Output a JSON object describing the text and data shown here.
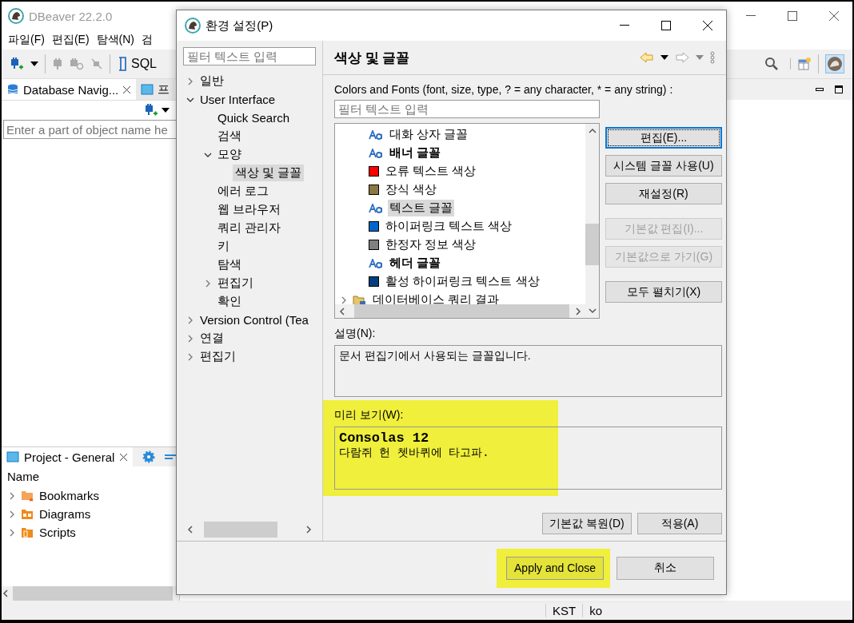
{
  "app_window": {
    "title": "DBeaver 22.2.0",
    "menu": [
      "파일(F)",
      "편집(E)",
      "탐색(N)",
      "검"
    ],
    "toolbar": {
      "sql_label": "SQL"
    },
    "navigator": {
      "tabs": [
        {
          "label": "Database Navig...",
          "selected": true,
          "closable": true
        },
        {
          "label": "프",
          "selected": false,
          "closable": false
        }
      ],
      "search": {
        "placeholder": "Enter a part of object name he"
      }
    },
    "project": {
      "tab": "Project - General",
      "column": "Name",
      "items": [
        {
          "kind": "bookmarks",
          "label": "Bookmarks",
          "expanded": false
        },
        {
          "kind": "diagrams",
          "label": "Diagrams",
          "expanded": false
        },
        {
          "kind": "scripts",
          "label": "Scripts",
          "expanded": false
        }
      ]
    },
    "status_bar": [
      "KST",
      "ko"
    ]
  },
  "dialog": {
    "title": "환경 설정(P)",
    "filter": {
      "placeholder": "필터 텍스트 입력"
    },
    "tree": [
      {
        "label": "일반",
        "expanded": false,
        "selected": false
      },
      {
        "label": "User Interface",
        "expanded": true,
        "selected": false,
        "children": [
          {
            "label": "Quick Search",
            "selected": false
          },
          {
            "label": "검색",
            "selected": false
          },
          {
            "label": "모양",
            "expanded": true,
            "selected": false,
            "children": [
              {
                "label": "색상 및 글꼴",
                "selected": true
              }
            ]
          },
          {
            "label": "에러 로그",
            "selected": false
          },
          {
            "label": "웹 브라우저",
            "selected": false
          },
          {
            "label": "쿼리 관리자",
            "selected": false
          },
          {
            "label": "키",
            "selected": false
          },
          {
            "label": "탐색",
            "selected": false
          },
          {
            "label": "편집기",
            "expanded": false,
            "selected": false
          },
          {
            "label": "확인",
            "selected": false
          }
        ]
      },
      {
        "label": "Version Control (Tea",
        "expanded": false,
        "selected": false
      },
      {
        "label": "연결",
        "expanded": false,
        "selected": false
      },
      {
        "label": "편집기",
        "expanded": false,
        "selected": false
      }
    ],
    "page": {
      "title": "색상 및 글꼴",
      "list_label": "Colors and Fonts (font, size, type, ? = any character, * = any string) :",
      "filter": {
        "placeholder": "필터 텍스트 입력"
      },
      "items": [
        {
          "kind": "font",
          "label": "대화 상자 글꼴",
          "bold": false,
          "selected": false
        },
        {
          "kind": "font",
          "label": "배너 글꼴",
          "bold": true,
          "selected": false
        },
        {
          "kind": "color",
          "label": "오류 텍스트 색상",
          "color": "#ff0000",
          "selected": false
        },
        {
          "kind": "color",
          "label": "장식 색상",
          "color": "#8b7845",
          "selected": false
        },
        {
          "kind": "font",
          "label": "텍스트 글꼴",
          "bold": false,
          "selected": true
        },
        {
          "kind": "color",
          "label": "하이퍼링크 텍스트 색상",
          "color": "#0066cc",
          "selected": false
        },
        {
          "kind": "color",
          "label": "한정자 정보 색상",
          "color": "#808080",
          "selected": false
        },
        {
          "kind": "font",
          "label": "헤더 글꼴",
          "bold": true,
          "selected": false
        },
        {
          "kind": "color",
          "label": "활성 하이퍼링크 텍스트 색상",
          "color": "#004080",
          "selected": false
        },
        {
          "kind": "category",
          "label": "데이터베이스 쿼리 결과",
          "expanded": false,
          "selected": false
        }
      ],
      "side_buttons": [
        {
          "label": "편집(E)...",
          "disabled": false,
          "focused": true
        },
        {
          "label": "시스템 글꼴 사용(U)",
          "disabled": false,
          "focused": false
        },
        {
          "label": "재설정(R)",
          "disabled": false,
          "focused": false
        },
        {
          "label": "기본값 편집(I)...",
          "disabled": true,
          "focused": false
        },
        {
          "label": "기본값으로 가기(G)",
          "disabled": true,
          "focused": false
        },
        {
          "label": "모두 펼치기(X)",
          "disabled": false,
          "focused": false
        }
      ],
      "description_label": "설명(N):",
      "description": "문서 편집기에서 사용되는 글꼴입니다.",
      "preview_label": "미리 보기(W):",
      "preview": {
        "title": "Consolas 12",
        "sample": "다람쥐 헌 쳇바퀴에 타고파.",
        "highlighted": true
      },
      "page_buttons": [
        "기본값 복원(D)",
        "적용(A)"
      ]
    },
    "buttons": [
      {
        "label": "Apply and Close",
        "highlighted": true
      },
      {
        "label": "취소",
        "highlighted": false
      }
    ]
  }
}
